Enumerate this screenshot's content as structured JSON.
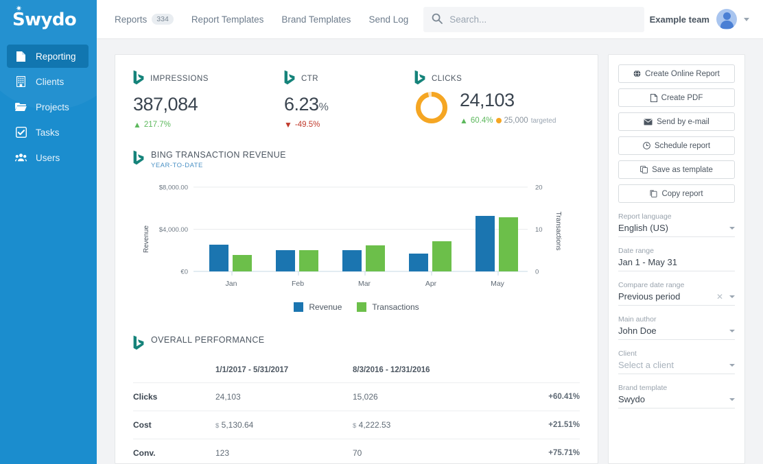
{
  "brand": {
    "name": "Swydo",
    "sidebar_bg": "#1b8dce",
    "active_bg": "#1176b0"
  },
  "sidebar": {
    "items": [
      {
        "label": "Reporting",
        "icon": "document-icon",
        "active": true
      },
      {
        "label": "Clients",
        "icon": "building-icon",
        "active": false
      },
      {
        "label": "Projects",
        "icon": "folder-icon",
        "active": false
      },
      {
        "label": "Tasks",
        "icon": "checkbox-icon",
        "active": false
      },
      {
        "label": "Users",
        "icon": "users-icon",
        "active": false
      }
    ]
  },
  "topbar": {
    "nav": [
      {
        "label": "Reports",
        "count": "334"
      },
      {
        "label": "Report Templates",
        "count": ""
      },
      {
        "label": "Brand Templates",
        "count": ""
      },
      {
        "label": "Send Log",
        "count": ""
      }
    ],
    "search_placeholder": "Search...",
    "search_value": "",
    "team": "Example team"
  },
  "kpis": [
    {
      "title": "IMPRESSIONS",
      "value": "387,084",
      "unit": "",
      "delta": "217.7%",
      "direction": "up",
      "source": "bing-icon"
    },
    {
      "title": "CTR",
      "value": "6.23",
      "unit": "%",
      "delta": "-49.5%",
      "direction": "down",
      "source": "bing-icon"
    },
    {
      "title": "CLICKS",
      "value": "24,103",
      "unit": "",
      "delta": "60.4%",
      "direction": "up",
      "source": "bing-icon",
      "target_label": "25,000",
      "target_suffix": "targeted",
      "donut_pct": 96,
      "donut_color": "#f5a623"
    }
  ],
  "chart_section": {
    "title": "BING TRANSACTION REVENUE",
    "subtitle": "YEAR-TO-DATE"
  },
  "chart_data": {
    "type": "bar",
    "title": "BING TRANSACTION REVENUE",
    "subtitle": "YEAR-TO-DATE",
    "categories": [
      "Jan",
      "Feb",
      "Mar",
      "Apr",
      "May"
    ],
    "series": [
      {
        "name": "Revenue",
        "color": "#1b75b0",
        "axis": "left",
        "values": [
          2560,
          2000,
          2000,
          1700,
          5250
        ]
      },
      {
        "name": "Transactions",
        "color": "#6cbf4a",
        "axis": "right",
        "values": [
          4,
          5,
          6,
          7,
          13
        ]
      }
    ],
    "xlabel": "",
    "ylabel": "Revenue",
    "y2label": "Transactions",
    "ylim": [
      0,
      8000
    ],
    "y2lim": [
      0,
      20
    ],
    "yticks": [
      "€0",
      "$4,000.00",
      "$8,000.00"
    ],
    "y2ticks": [
      "0",
      "10",
      "20"
    ],
    "grid": true,
    "legend_position": "bottom"
  },
  "performance": {
    "title": "OVERALL PERFORMANCE",
    "columns": [
      "",
      "1/1/2017 - 5/31/2017",
      "8/3/2016 - 12/31/2016",
      ""
    ],
    "rows": [
      {
        "label": "Clicks",
        "current": "24,103",
        "current_sym": "",
        "previous": "15,026",
        "previous_sym": "",
        "change": "+60.41%",
        "change_dir": "pos"
      },
      {
        "label": "Cost",
        "current": "5,130.64",
        "current_sym": "$",
        "previous": "4,222.53",
        "previous_sym": "$",
        "change": "+21.51%",
        "change_dir": "neg"
      },
      {
        "label": "Conv.",
        "current": "123",
        "current_sym": "",
        "previous": "70",
        "previous_sym": "",
        "change": "+75.71%",
        "change_dir": "pos"
      }
    ]
  },
  "side_panel": {
    "buttons": [
      {
        "label": "Create Online Report",
        "icon": "globe-icon"
      },
      {
        "label": "Create PDF",
        "icon": "pdf-icon"
      },
      {
        "label": "Send by e-mail",
        "icon": "envelope-icon"
      },
      {
        "label": "Schedule report",
        "icon": "clock-icon"
      },
      {
        "label": "Save as template",
        "icon": "copy-icon"
      },
      {
        "label": "Copy report",
        "icon": "duplicate-icon"
      }
    ],
    "fields": [
      {
        "label": "Report language",
        "value": "English (US)",
        "placeholder": false,
        "clearable": false
      },
      {
        "label": "Date range",
        "value": "Jan 1 - May 31",
        "placeholder": false,
        "clearable": false,
        "no_caret": true
      },
      {
        "label": "Compare date range",
        "value": "Previous period",
        "placeholder": false,
        "clearable": true
      },
      {
        "label": "Main author",
        "value": "John Doe",
        "placeholder": false,
        "clearable": false
      },
      {
        "label": "Client",
        "value": "Select a client",
        "placeholder": true,
        "clearable": false
      },
      {
        "label": "Brand template",
        "value": "Swydo",
        "placeholder": false,
        "clearable": false
      }
    ]
  }
}
